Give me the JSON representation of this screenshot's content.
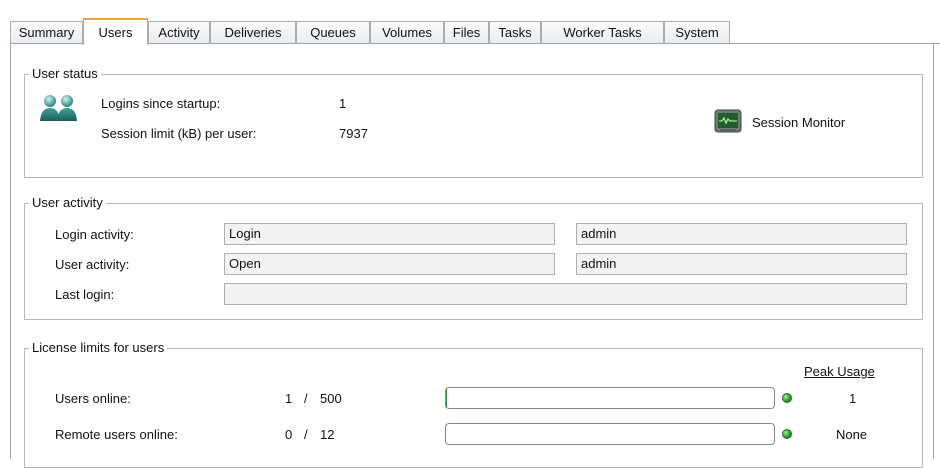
{
  "tabs": [
    {
      "label": "Summary",
      "active": false
    },
    {
      "label": "Users",
      "active": true
    },
    {
      "label": "Activity",
      "active": false
    },
    {
      "label": "Deliveries",
      "active": false
    },
    {
      "label": "Queues",
      "active": false
    },
    {
      "label": "Volumes",
      "active": false
    },
    {
      "label": "Files",
      "active": false
    },
    {
      "label": "Tasks",
      "active": false
    },
    {
      "label": "Worker Tasks",
      "active": false
    },
    {
      "label": "System",
      "active": false
    }
  ],
  "user_status": {
    "title": "User status",
    "logins_label": "Logins since startup:",
    "logins_value": "1",
    "session_limit_label": "Session limit (kB) per user:",
    "session_limit_value": "7937",
    "session_monitor_label": "Session Monitor",
    "icons": {
      "users": "users-icon",
      "monitor": "session-monitor-icon"
    }
  },
  "user_activity": {
    "title": "User activity",
    "rows": [
      {
        "label": "Login activity:",
        "action": "Login",
        "user": "admin"
      },
      {
        "label": "User activity:",
        "action": "Open",
        "user": "admin"
      },
      {
        "label": "Last login:",
        "value": ""
      }
    ]
  },
  "license_limits": {
    "title": "License limits for users",
    "peak_usage_header": "Peak Usage",
    "rows": [
      {
        "label": "Users online:",
        "current": "1",
        "sep": "/",
        "max": "500",
        "usage_fraction": 0.002,
        "status": "green",
        "peak": "1"
      },
      {
        "label": "Remote users online:",
        "current": "0",
        "sep": "/",
        "max": "12",
        "usage_fraction": 0.0,
        "status": "green",
        "peak": "None"
      }
    ]
  },
  "colors": {
    "active_tab_accent": "#f0a23a",
    "status_green": "#1f9a1f"
  }
}
